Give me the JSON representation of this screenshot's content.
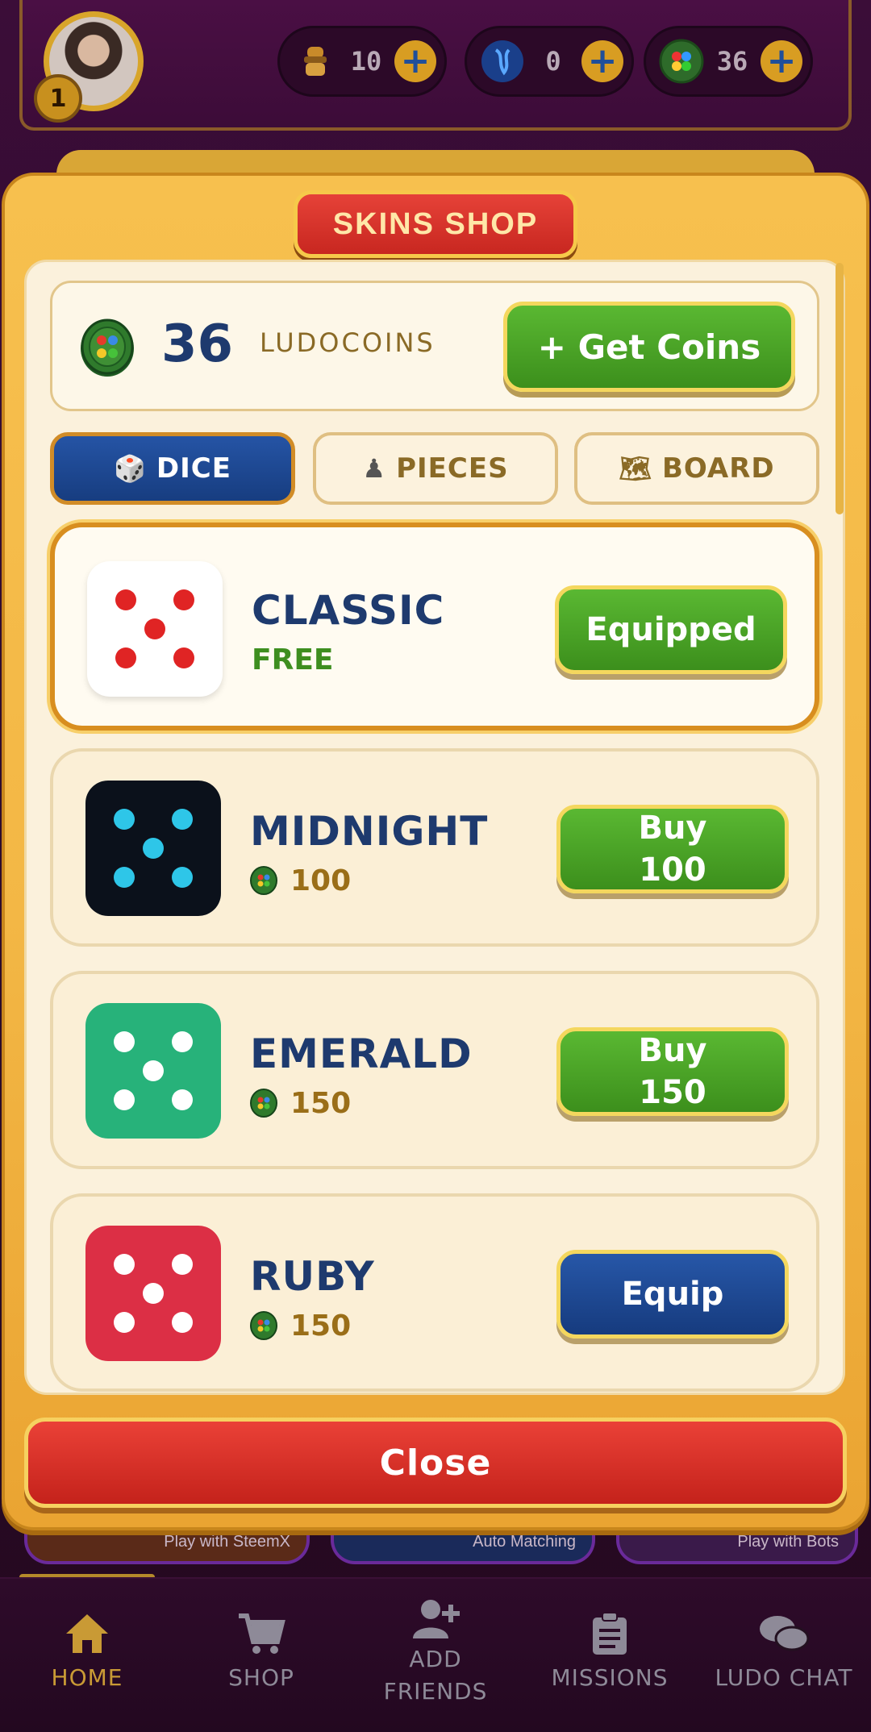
{
  "header": {
    "level": "1",
    "currencies": [
      {
        "icon": "trophy-token-icon",
        "value": "10"
      },
      {
        "icon": "steem-icon",
        "value": "0"
      },
      {
        "icon": "ludocoin-icon",
        "value": "36"
      }
    ]
  },
  "modal": {
    "title": "SKINS SHOP",
    "coins": {
      "value": "36",
      "label": "LUDOCOINS",
      "get_coins_label": "+ Get Coins"
    },
    "tabs": [
      {
        "label": "DICE",
        "icon": "🎲",
        "active": true
      },
      {
        "label": "PIECES",
        "icon": "♟",
        "active": false
      },
      {
        "label": "BOARD",
        "icon": "🗺",
        "active": false
      }
    ],
    "skins": [
      {
        "name": "CLASSIC",
        "price": "FREE",
        "button": "Equipped",
        "face_color": "#ffffff",
        "pip_color": "#e02424"
      },
      {
        "name": "MIDNIGHT",
        "price": "100",
        "button_line1": "Buy",
        "button_line2": "100",
        "face_color": "#0b111b",
        "pip_color": "#2ec6e8"
      },
      {
        "name": "EMERALD",
        "price": "150",
        "button_line1": "Buy",
        "button_line2": "150",
        "face_color": "#27b27a",
        "pip_color": "#ffffff"
      },
      {
        "name": "RUBY",
        "price": "150",
        "button": "Equip",
        "face_color": "#dc2f45",
        "pip_color": "#ffffff"
      }
    ],
    "close_label": "Close"
  },
  "background": {
    "game_cards": [
      "Play with SteemX",
      "Auto Matching",
      "Play with Bots"
    ]
  },
  "nav": {
    "items": [
      {
        "label": "HOME",
        "icon": "home-icon",
        "active": true
      },
      {
        "label": "SHOP",
        "icon": "cart-icon",
        "active": false
      },
      {
        "label": "ADD FRIENDS",
        "line1": "ADD",
        "line2": "FRIENDS",
        "icon": "add-user-icon",
        "active": false
      },
      {
        "label": "MISSIONS",
        "icon": "clipboard-icon",
        "active": false
      },
      {
        "label": "LUDO CHAT",
        "icon": "chat-icon",
        "active": false
      }
    ]
  },
  "colors": {
    "accent_gold": "#f3b745",
    "primary_green": "#4aa628",
    "primary_blue": "#1e4a95",
    "close_red": "#d8322a",
    "title_navy": "#1e3a6e"
  }
}
